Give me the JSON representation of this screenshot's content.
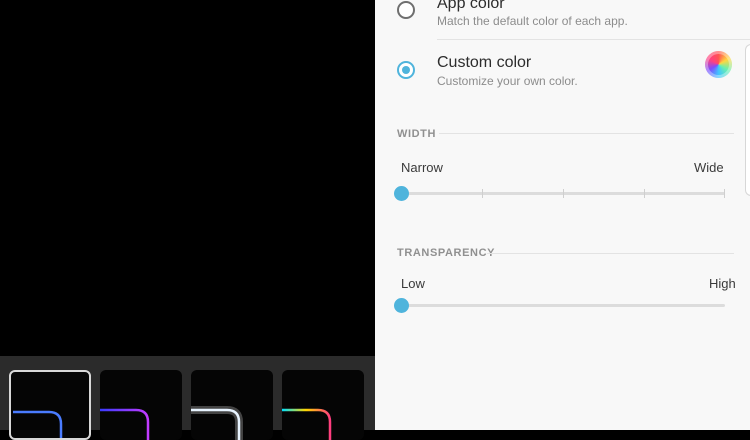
{
  "color_options": [
    {
      "title": "App color",
      "subtitle": "Match the default color of each app.",
      "selected": false
    },
    {
      "title": "Custom color",
      "subtitle": "Customize your own color.",
      "selected": true
    }
  ],
  "width": {
    "header": "WIDTH",
    "min_label": "Narrow",
    "max_label": "Wide",
    "value_fraction": 0.0,
    "steps": 5
  },
  "transparency": {
    "header": "TRANSPARENCY",
    "min_label": "Low",
    "max_label": "High",
    "value_fraction": 0.0
  },
  "icons": {
    "color_picker": "color-wheel-icon"
  },
  "colors": {
    "accent": "#4fb4dc",
    "panel_bg": "#f8f8f8",
    "strip_bg": "#2b2b2b"
  }
}
